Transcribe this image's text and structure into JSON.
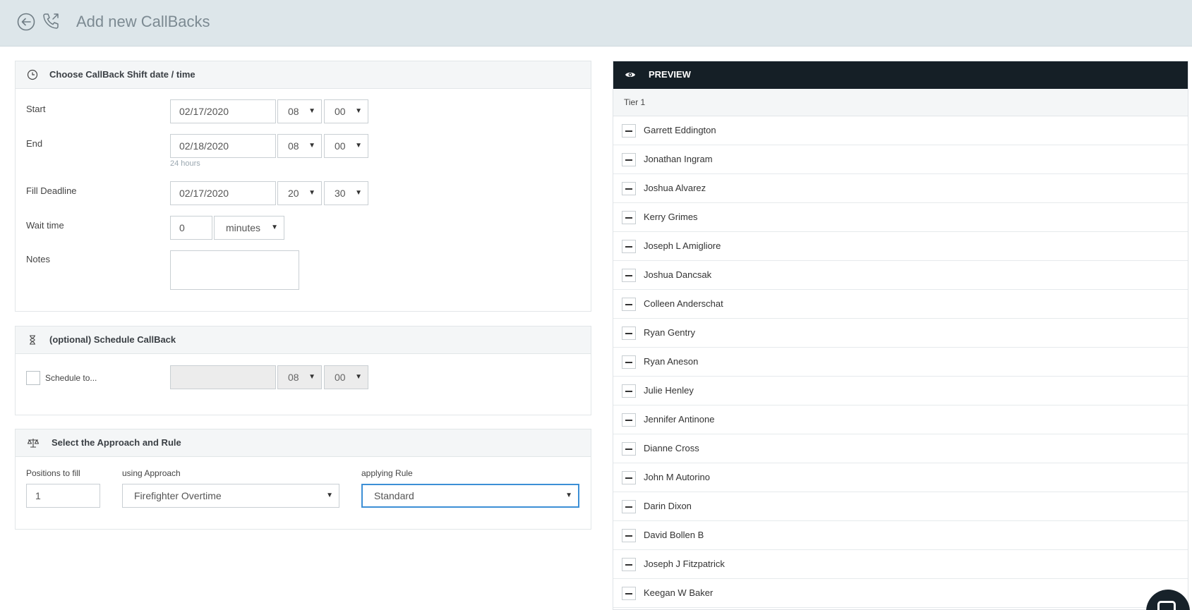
{
  "header": {
    "title": "Add new CallBacks"
  },
  "shift_panel": {
    "title": "Choose CallBack Shift date / time",
    "start": {
      "label": "Start",
      "date": "02/17/2020",
      "hour": "08",
      "minute": "00"
    },
    "end": {
      "label": "End",
      "date": "02/18/2020",
      "hour": "08",
      "minute": "00",
      "duration": "24 hours"
    },
    "fill_deadline": {
      "label": "Fill Deadline",
      "date": "02/17/2020",
      "hour": "20",
      "minute": "30"
    },
    "wait_time": {
      "label": "Wait time",
      "value": "0",
      "unit": "minutes"
    },
    "notes": {
      "label": "Notes",
      "value": ""
    }
  },
  "schedule_panel": {
    "title": "(optional) Schedule CallBack",
    "checkbox_label": "Schedule to...",
    "checked": false,
    "date": "",
    "hour": "08",
    "minute": "00"
  },
  "approach_panel": {
    "title": "Select the Approach and Rule",
    "positions_label": "Positions to fill",
    "positions_value": "1",
    "approach_label": "using Approach",
    "approach_value": "Firefighter Overtime",
    "rule_label": "applying Rule",
    "rule_value": "Standard"
  },
  "preview": {
    "title": "PREVIEW",
    "tier_label": "Tier 1",
    "people": [
      "Garrett Eddington",
      "Jonathan Ingram",
      "Joshua Alvarez",
      "Kerry Grimes",
      "Joseph L Amigliore",
      "Joshua Dancsak",
      "Colleen Anderschat",
      "Ryan Gentry",
      "Ryan Aneson",
      "Julie Henley",
      "Jennifer Antinone",
      "Dianne Cross",
      "John M Autorino",
      "Darin Dixon",
      "David Bollen B",
      "Joseph J Fitzpatrick",
      "Keegan W Baker"
    ]
  },
  "colors": {
    "header_bg": "#dde6ea",
    "preview_header_bg": "#151f26",
    "focus_border": "#3c8fd6"
  }
}
